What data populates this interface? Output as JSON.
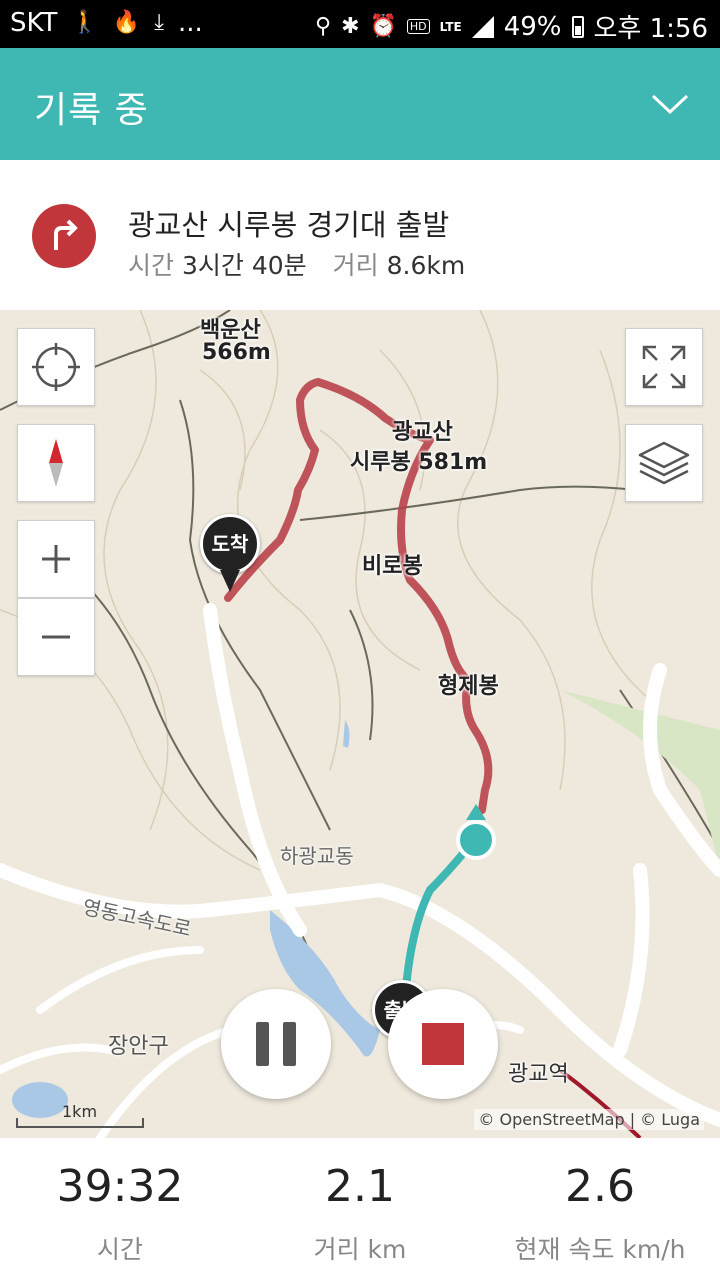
{
  "status_bar": {
    "carrier": "SKT",
    "overflow": "...",
    "battery": "49%",
    "time": "오후 1:56",
    "hd_label": "HD",
    "lte_label": "LTE"
  },
  "header": {
    "title": "기록 중"
  },
  "route": {
    "title": "광교산 시루봉 경기대 출발",
    "time_label": "시간",
    "time_value": "3시간 40분",
    "distance_label": "거리",
    "distance_value": "8.6km"
  },
  "map": {
    "labels": {
      "baekunsan": "백운산",
      "baekunsan_elev": "566m",
      "gwanggyosan": "광교산",
      "sirubong": "시루봉 581m",
      "birobong": "비로봉",
      "hyeongjebong": "형제봉",
      "hagwanggyo": "하광교동",
      "expressway": "영동고속도로",
      "jangan": "장안구",
      "station": "광교역"
    },
    "pins": {
      "arrival": "도착",
      "departure": "출발"
    },
    "scale": "1km",
    "attribution": "© OpenStreetMap | © Luga"
  },
  "stats": {
    "time_value": "39:32",
    "time_label": "시간",
    "distance_value": "2.1",
    "distance_label": "거리 km",
    "speed_value": "2.6",
    "speed_label": "현재 속도 km/h"
  },
  "colors": {
    "header_bg": "#3fb8b4",
    "route_red": "#c0363b",
    "track_teal": "#3fb8b4"
  }
}
